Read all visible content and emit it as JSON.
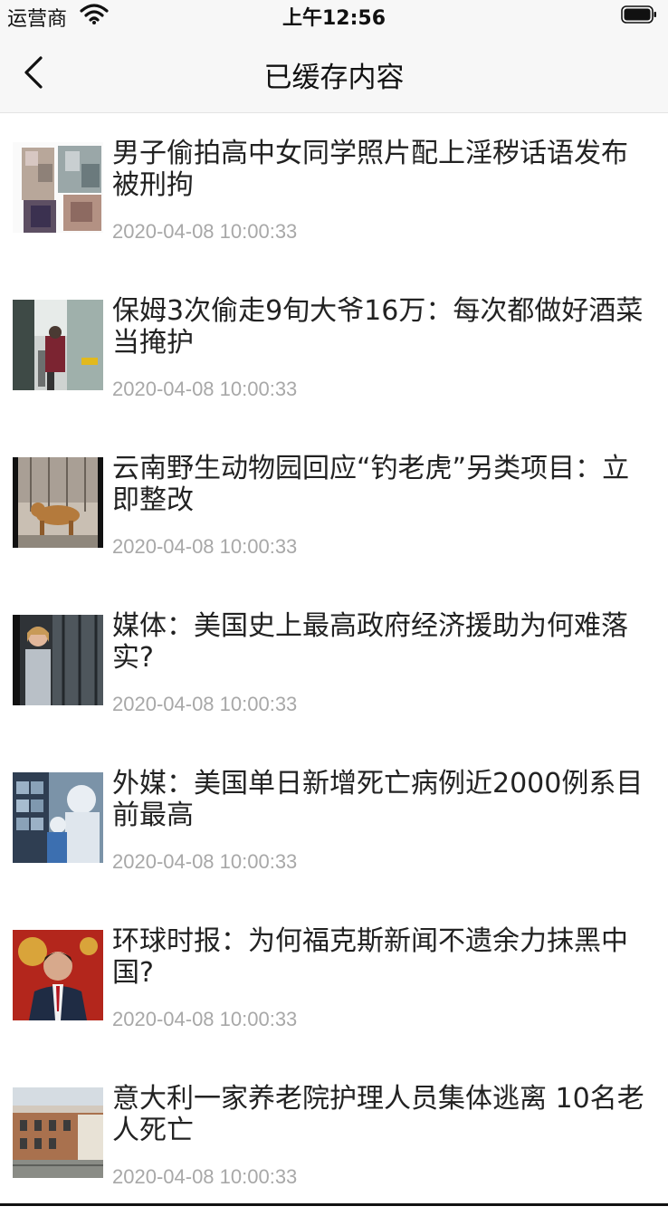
{
  "status_bar": {
    "carrier": "运营商",
    "time": "上午12:56"
  },
  "nav": {
    "title": "已缓存内容"
  },
  "items": [
    {
      "title": "男子偷拍高中女同学照片配上淫秽话语发布 被刑拘",
      "date": "2020-04-08 10:00:33",
      "thumb": "blurred-photo-collage"
    },
    {
      "title": "保姆3次偷走9旬大爷16万：每次都做好酒菜当掩护",
      "date": "2020-04-08 10:00:33",
      "thumb": "surveillance-photo"
    },
    {
      "title": "云南野生动物园回应“钓老虎”另类项目：立即整改",
      "date": "2020-04-08 10:00:33",
      "thumb": "tiger-photo"
    },
    {
      "title": "媒体：美国史上最高政府经济援助为何难落实?",
      "date": "2020-04-08 10:00:33",
      "thumb": "woman-at-door-photo"
    },
    {
      "title": "外媒：美国单日新增死亡病例近2000例系目前最高",
      "date": "2020-04-08 10:00:33",
      "thumb": "medical-staff-photo"
    },
    {
      "title": "环球时报：为何福克斯新闻不遗余力抹黑中国?",
      "date": "2020-04-08 10:00:33",
      "thumb": "news-anchor-photo"
    },
    {
      "title": "意大利一家养老院护理人员集体逃离 10名老人死亡",
      "date": "2020-04-08 10:00:33",
      "thumb": "building-photo"
    }
  ]
}
